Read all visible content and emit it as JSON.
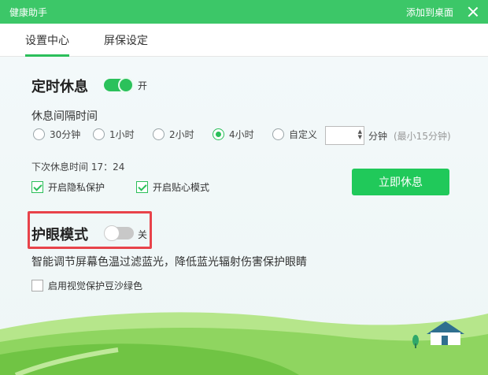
{
  "titlebar": {
    "title": "健康助手",
    "add_to_desktop": "添加到桌面"
  },
  "tabs": [
    {
      "label": "设置中心",
      "active": true
    },
    {
      "label": "屏保设定",
      "active": false
    }
  ],
  "timed_rest": {
    "title": "定时休息",
    "toggle_on": true,
    "toggle_label": "开",
    "interval_label": "休息间隔时间",
    "options": [
      {
        "label": "30分钟",
        "checked": false
      },
      {
        "label": "1小时",
        "checked": false
      },
      {
        "label": "2小时",
        "checked": false
      },
      {
        "label": "4小时",
        "checked": true
      },
      {
        "label": "自定义",
        "checked": false
      }
    ],
    "custom_value": "",
    "minutes_label": "分钟",
    "minutes_hint": "(最小15分钟)",
    "next_rest": "下次休息时间 17：24",
    "privacy_label": "开启隐私保护",
    "privacy_checked": true,
    "care_label": "开启贴心模式",
    "care_checked": true,
    "rest_now_button": "立即休息"
  },
  "eye_mode": {
    "title": "护眼模式",
    "toggle_on": false,
    "toggle_label": "关",
    "description": "智能调节屏幕色温过滤蓝光，降低蓝光辐射伤害保护眼睛",
    "bean_green_label": "启用视觉保护豆沙绿色",
    "bean_green_checked": false
  },
  "colors": {
    "brand_green": "#3cc768",
    "accent_green": "#20c95a",
    "highlight_red": "#e8434a"
  }
}
